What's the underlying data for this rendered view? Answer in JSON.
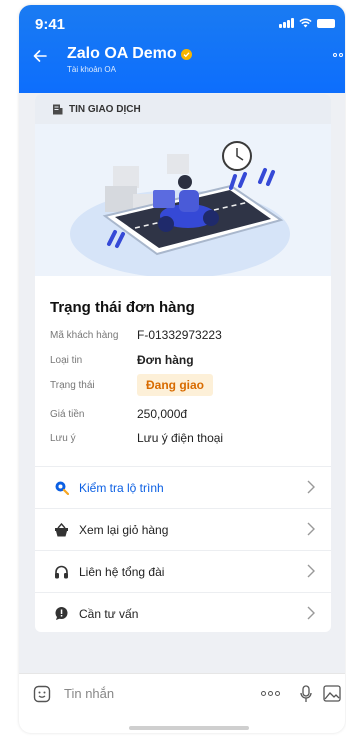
{
  "status_bar": {
    "time": "9:41"
  },
  "header": {
    "title": "Zalo OA Demo",
    "subtitle": "Tài khoản OA"
  },
  "card": {
    "section_label": "TIN GIAO DỊCH",
    "order_title": "Trạng thái đơn hàng",
    "fields": [
      {
        "label": "Mã khách hàng",
        "value": "F-01332973223"
      },
      {
        "label": "Loại tin",
        "value": "Đơn hàng"
      },
      {
        "label": "Trạng thái",
        "value": "Đang giao"
      },
      {
        "label": "Giá tiền",
        "value": "250,000đ"
      },
      {
        "label": "Lưu ý",
        "value": "Lưu ý điện thoại"
      }
    ],
    "actions": [
      {
        "label": "Kiểm tra lộ trình",
        "icon": "route-search-icon"
      },
      {
        "label": "Xem lại giỏ hàng",
        "icon": "cart-icon"
      },
      {
        "label": "Liên hệ tổng đài",
        "icon": "headphones-icon"
      },
      {
        "label": "Cần tư vấn",
        "icon": "chat-bubble-icon"
      }
    ]
  },
  "composer": {
    "placeholder": "Tin nhắn"
  },
  "colors": {
    "brand": "#0d6efd",
    "status_badge_bg": "#fdf0d8",
    "status_badge_text": "#d86b00",
    "primary_link": "#0b5fe3"
  }
}
